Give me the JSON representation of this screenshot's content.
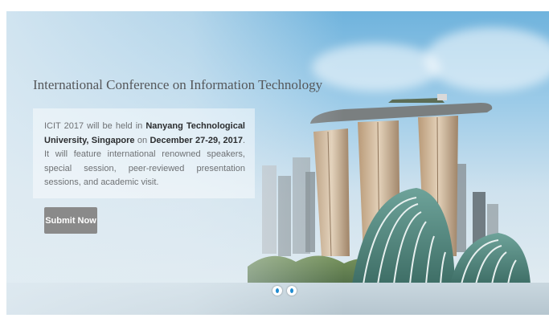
{
  "hero": {
    "title": "International Conference on Information Technology",
    "description": {
      "p1": "ICIT 2017 will be held in ",
      "venue": "Nanyang Technological University, Singapore",
      "p2": " on ",
      "date": "December 27-29, 2017",
      "p3": ". It will feature international renowned speakers, special session, peer-reviewed presentation sessions, and academic visit."
    },
    "submit_label": "Submit Now",
    "slides": [
      {
        "name": "slide-1"
      },
      {
        "name": "slide-2"
      }
    ]
  },
  "colors": {
    "button": "#8a8a8a",
    "title_text": "#55575a",
    "body_text": "#6e7174",
    "dot_accent": "#1f8bd0"
  },
  "image": {
    "subject": "Singapore skyline with Marina Bay Sands towers and Gardens by the Bay domes"
  }
}
